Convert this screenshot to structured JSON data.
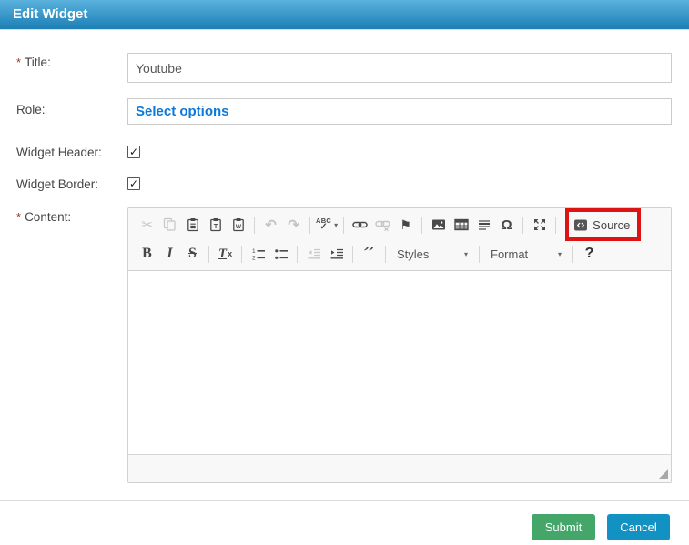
{
  "window": {
    "title": "Edit Widget"
  },
  "form": {
    "required_marker": "*",
    "title": {
      "label": "Title:",
      "value": "Youtube"
    },
    "role": {
      "label": "Role:",
      "value": "Select options"
    },
    "widget_header": {
      "label": "Widget Header:",
      "checked": "✓"
    },
    "widget_border": {
      "label": "Widget Border:",
      "checked": "✓"
    },
    "content": {
      "label": "Content:"
    }
  },
  "editor": {
    "cut_glyph": "✂",
    "undo_glyph": "↶",
    "redo_glyph": "↷",
    "spellcheck_label": "ABC",
    "spellcheck_check": "✓",
    "caret_glyph": "▾",
    "anchor_glyph": "⚑",
    "special_char_glyph": "Ω",
    "source_label": "Source",
    "bold_label": "B",
    "italic_label": "I",
    "strike_label": "S",
    "removeformat_t": "T",
    "removeformat_x": "x",
    "blockquote_glyph": "”",
    "styles_label": "Styles",
    "format_label": "Format",
    "about_label": "?"
  },
  "footer": {
    "submit_label": "Submit",
    "cancel_label": "Cancel"
  },
  "colors": {
    "header_top": "#5ab2dd",
    "header_bottom": "#1e7fb5",
    "link_blue": "#0c79da",
    "submit_green": "#44a769",
    "cancel_blue": "#1291c3",
    "highlight_red": "#dd1414"
  }
}
